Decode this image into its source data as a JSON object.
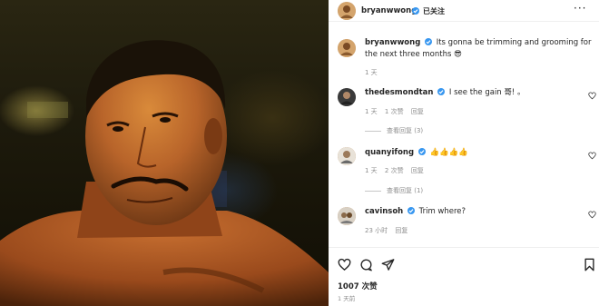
{
  "post": {
    "author": "bryanwwong",
    "follow_label": "已关注",
    "more_icon": "more-horizontal-icon",
    "caption": "Its gonna be trimming and grooming for the next three months 😎",
    "caption_time": "1 天",
    "likes": "1007 次赞",
    "date": "1 天前"
  },
  "comments": [
    {
      "user": "thedesmondtan",
      "text": "I see the gain 哥! 。",
      "time": "1 天",
      "likes": "1 次赞",
      "reply": "回复",
      "view_replies": "查看回复 (3)"
    },
    {
      "user": "quanyifong",
      "text": "👍👍👍👍",
      "time": "1 天",
      "likes": "2 次赞",
      "reply": "回复",
      "view_replies": "查看回复 (1)"
    },
    {
      "user": "cavinsoh",
      "text": "Trim where?",
      "time": "23 小时",
      "reply": "回复"
    }
  ],
  "colors": {
    "verified": "#3897f0",
    "secondary_text": "#8e8e8e"
  }
}
